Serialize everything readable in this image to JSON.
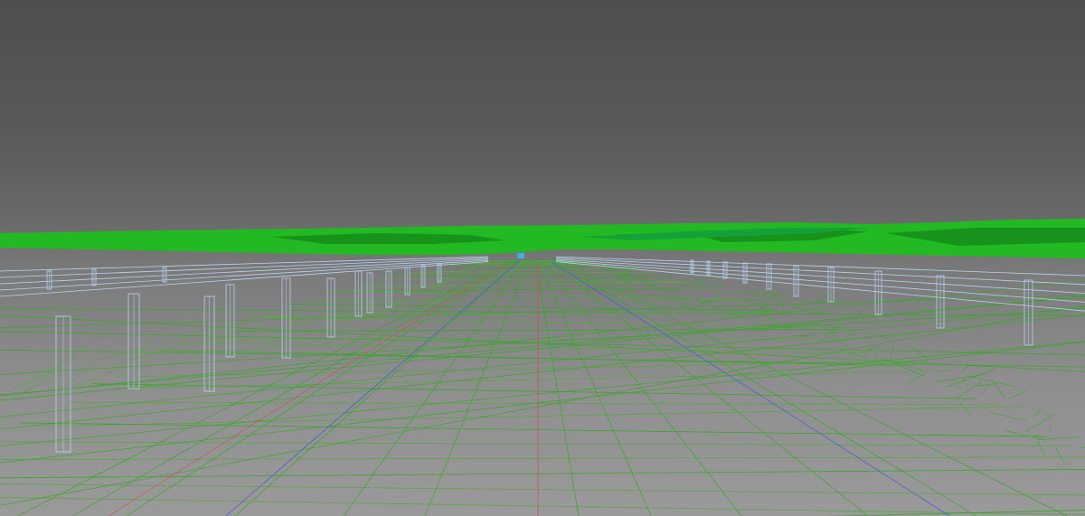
{
  "viewport": {
    "type": "3d-wireframe-viewport",
    "colors": {
      "background_top": "#4e4e4e",
      "background_bottom": "#9a9a9a",
      "terrain": "#22b922",
      "terrain_dark": "#17931c",
      "terrain_far": "#16a03a",
      "wire_green": "#3aa52a",
      "wire_dim": "#5ea34a",
      "structure_wire": "#b9d3f0",
      "axis_red": "#c8505a",
      "axis_blue": "#4a5fd0",
      "marker_blue": "#4aa8e6"
    },
    "icons": [
      "camera-target-marker"
    ]
  }
}
